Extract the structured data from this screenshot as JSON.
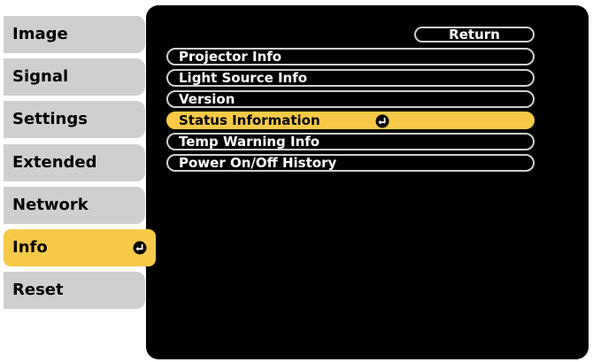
{
  "colors": {
    "panel_background": "#000000",
    "tab_background": "#cfcfcf",
    "selection_highlight": "#f7c948",
    "text_light": "#ffffff",
    "text_dark": "#000000"
  },
  "sidebar": {
    "tabs": [
      {
        "label": "Image",
        "selected": false
      },
      {
        "label": "Signal",
        "selected": false
      },
      {
        "label": "Settings",
        "selected": false
      },
      {
        "label": "Extended",
        "selected": false
      },
      {
        "label": "Network",
        "selected": false
      },
      {
        "label": "Info",
        "selected": true,
        "icon": "enter-icon"
      },
      {
        "label": "Reset",
        "selected": false
      }
    ]
  },
  "menu": {
    "return_label": "Return",
    "items": [
      {
        "label": "Projector Info",
        "selected": false
      },
      {
        "label": "Light Source Info",
        "selected": false
      },
      {
        "label": "Version",
        "selected": false
      },
      {
        "label": "Status Information",
        "selected": true,
        "icon": "enter-icon"
      },
      {
        "label": "Temp Warning Info",
        "selected": false
      },
      {
        "label": "Power On/Off History",
        "selected": false
      }
    ]
  }
}
